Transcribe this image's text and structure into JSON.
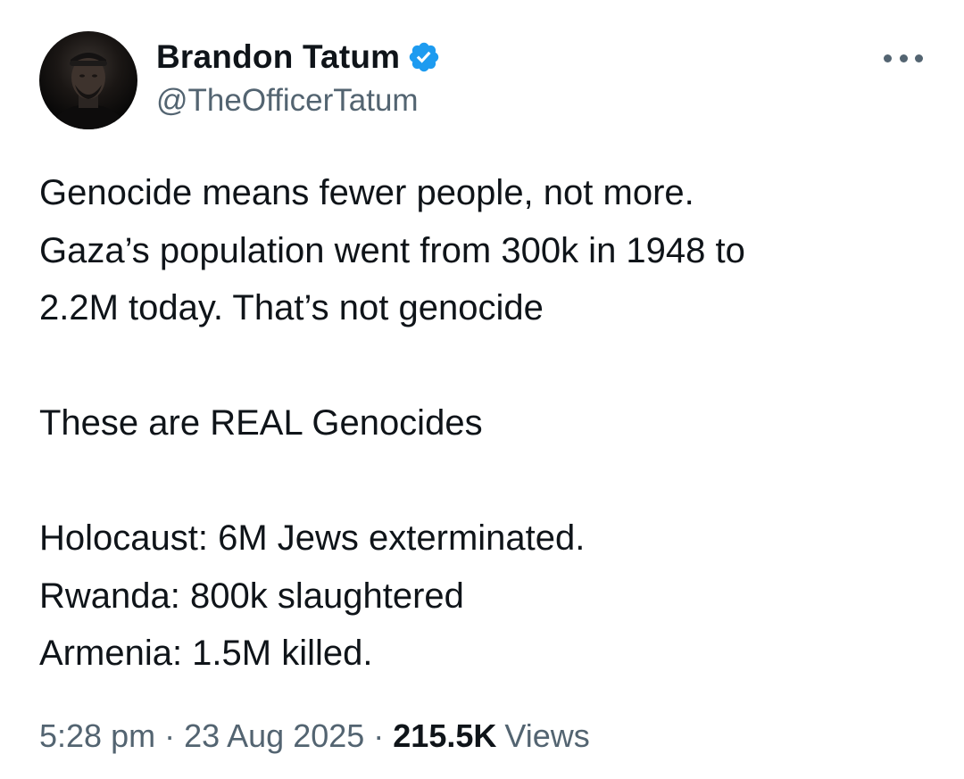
{
  "author": {
    "display_name": "Brandon Tatum",
    "handle": "@TheOfficerTatum",
    "verified": true,
    "verified_color": "#1d9bf0"
  },
  "tweet": {
    "lines": [
      "Genocide means fewer people, not more.",
      "Gaza’s population went from 300k in 1948 to",
      "2.2M today. That’s not genocide",
      "",
      "These are REAL Genocides",
      "",
      "Holocaust: 6M Jews exterminated.",
      "Rwanda: 800k slaughtered",
      "Armenia: 1.5M killed."
    ]
  },
  "meta": {
    "time": "5:28 pm",
    "separator": "·",
    "date": "23 Aug 2025",
    "views_count": "215.5K",
    "views_label": "Views"
  },
  "icons": {
    "avatar": "profile-photo",
    "verified": "verified-badge-icon",
    "more": "more-options-icon"
  },
  "colors": {
    "text_primary": "#0f1419",
    "text_secondary": "#536471",
    "accent": "#1d9bf0"
  }
}
